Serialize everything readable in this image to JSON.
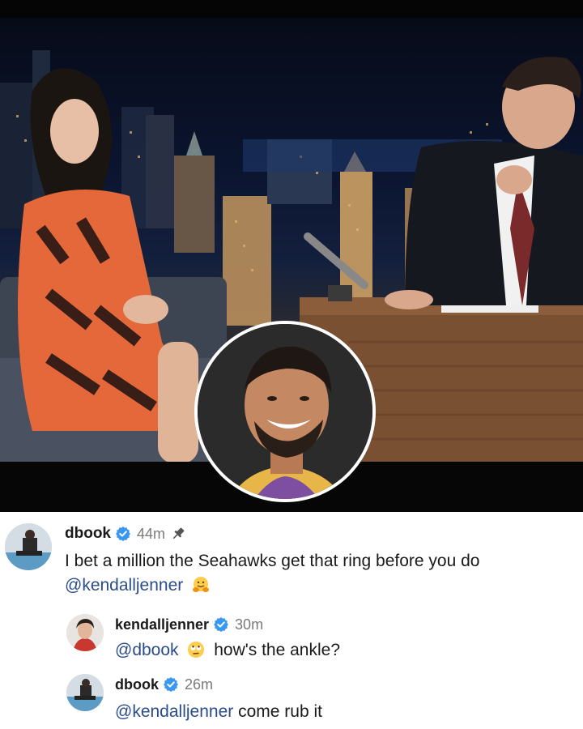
{
  "photo": {
    "description_icons": [
      "city-skyline",
      "talk-show-desk",
      "inset-portrait"
    ]
  },
  "comments": [
    {
      "username": "dbook",
      "time": "44m",
      "pinned": true,
      "text_before": "I bet a million the Seahawks get that ring before you do",
      "mention": "@kendalljenner",
      "emoji": "hugging-face-icon",
      "text_after": ""
    },
    {
      "username": "kendalljenner",
      "time": "30m",
      "pinned": false,
      "mention": "@dbook",
      "emoji": "face-with-rolling-eyes-icon",
      "text_after": "how's the ankle?"
    },
    {
      "username": "dbook",
      "time": "26m",
      "pinned": false,
      "mention": "@kendalljenner",
      "text_after": "come rub it"
    }
  ],
  "colors": {
    "verified": "#3897f0",
    "mention": "#2b4c8a",
    "meta": "#7a7a7a"
  }
}
